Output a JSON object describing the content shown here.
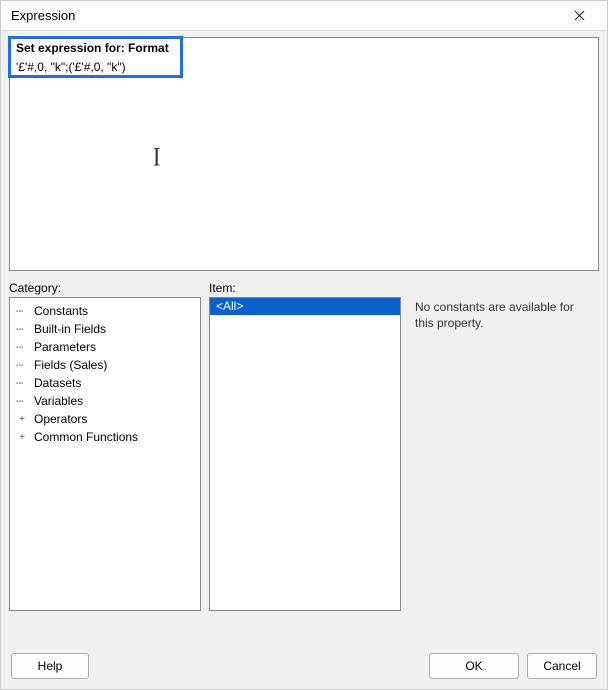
{
  "window": {
    "title": "Expression"
  },
  "editor": {
    "header": "Set expression for: Format",
    "value": "'£'#,0, \"k\";('£'#,0, \"k\")"
  },
  "labels": {
    "category": "Category:",
    "item": "Item:"
  },
  "category": {
    "items": [
      {
        "label": "Constants",
        "expander": ""
      },
      {
        "label": "Built-in Fields",
        "expander": ""
      },
      {
        "label": "Parameters",
        "expander": ""
      },
      {
        "label": "Fields (Sales)",
        "expander": ""
      },
      {
        "label": "Datasets",
        "expander": ""
      },
      {
        "label": "Variables",
        "expander": ""
      },
      {
        "label": "Operators",
        "expander": "+"
      },
      {
        "label": "Common Functions",
        "expander": "+"
      }
    ]
  },
  "itembox": {
    "items": [
      {
        "label": "<All>",
        "selected": true
      }
    ]
  },
  "description": {
    "text": "No constants are available for this property."
  },
  "buttons": {
    "help": "Help",
    "ok": "OK",
    "cancel": "Cancel"
  }
}
